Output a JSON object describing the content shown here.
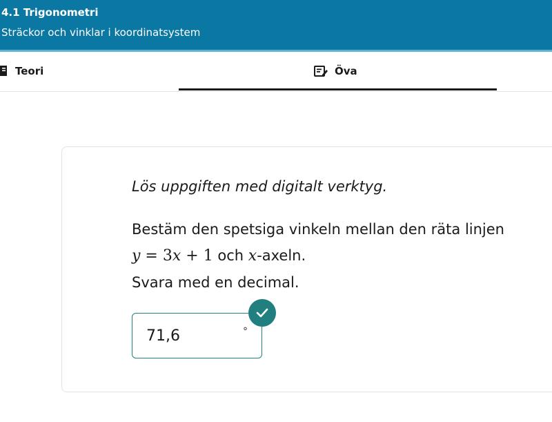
{
  "header": {
    "title": "4.1 Trigonometri",
    "subtitle": "Sträckor och vinklar i koordinatsystem"
  },
  "tabs": [
    {
      "label": "Teori",
      "icon": "book-icon",
      "active": false
    },
    {
      "label": "Öva",
      "icon": "edit-note-icon",
      "active": true
    }
  ],
  "exercise": {
    "instruction": "Lös uppgiften med digitalt verktyg.",
    "line1": "Bestäm den spetsiga vinkeln mellan den räta linjen",
    "equation": {
      "lhs": "y",
      "eq": " = 3",
      "x": "x",
      "rest": " + 1"
    },
    "line2_middle": " och ",
    "axis_var": "x",
    "line2_end": "-axeln.",
    "line3": "Svara med en decimal."
  },
  "answer": {
    "value": "71,6",
    "unit": "°",
    "status": "correct",
    "status_icon": "checkmark-icon"
  },
  "colors": {
    "header_bg": "#0b77a3",
    "accent": "#217f7f"
  }
}
